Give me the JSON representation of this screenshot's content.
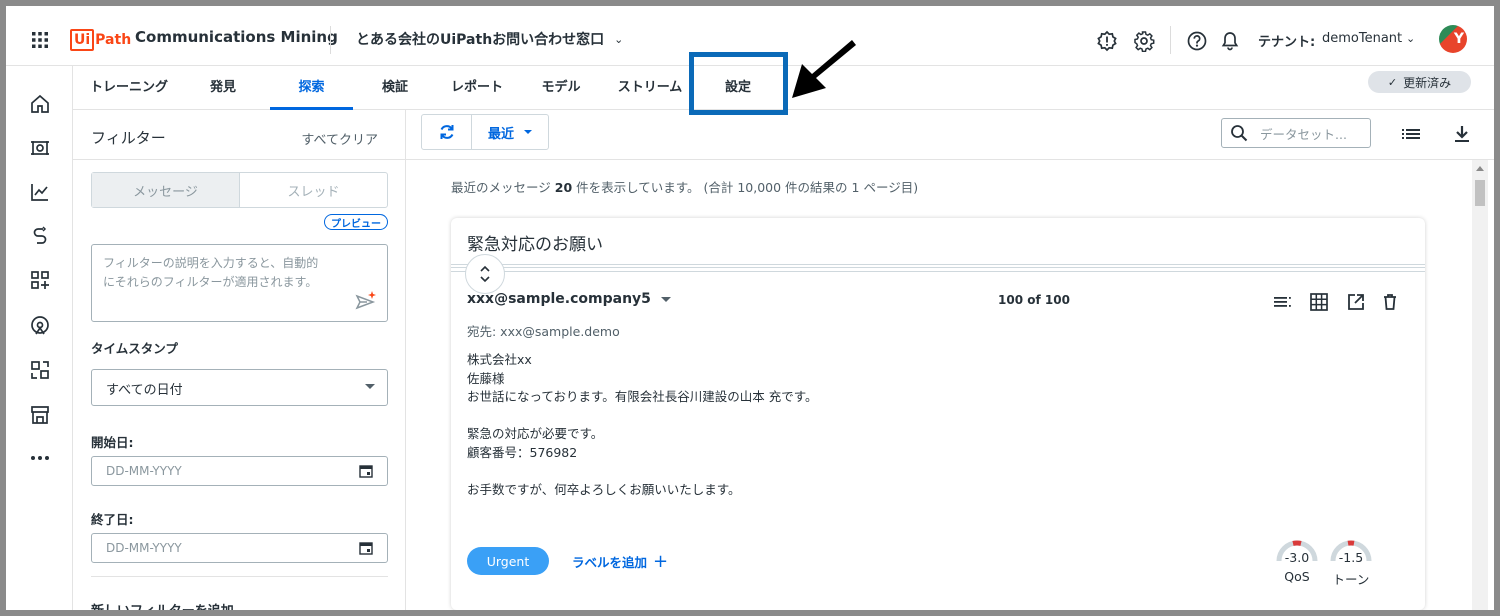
{
  "app": {
    "logo_box": "Ui",
    "logo_text": "Path",
    "product": "Communications Mining",
    "project": "とある会社のUiPathお問い合わせ窓口",
    "tenant_label": "テナント:",
    "tenant_value": "demoTenant",
    "avatar_initial": "Y"
  },
  "tabs": [
    "トレーニング",
    "発見",
    "探索",
    "検証",
    "レポート",
    "モデル",
    "ストリーム",
    "設定"
  ],
  "active_tab": "探索",
  "status": {
    "updated": "更新済み"
  },
  "filter": {
    "title": "フィルター",
    "clear": "すべてクリア",
    "segment": [
      "メッセージ",
      "スレッド"
    ],
    "preview_badge": "プレビュー",
    "description_placeholder_1": "フィルターの説明を入力すると、自動的",
    "description_placeholder_2": "にそれらのフィルターが適用されます。",
    "timestamp_label": "タイムスタンプ",
    "timestamp_value": "すべての日付",
    "start_label": "開始日:",
    "start_placeholder": "DD-MM-YYYY",
    "end_label": "終了日:",
    "end_placeholder": "DD-MM-YYYY",
    "add_filter": "新しいフィルターを追加"
  },
  "toolbar": {
    "sort": "最近",
    "search_placeholder": "データセット..."
  },
  "results": {
    "prefix": "最近のメッセージ",
    "count": "20",
    "suffix": "件を表示しています。 (合計 10,000 件の結果の 1 ページ目)"
  },
  "message": {
    "subject": "緊急対応のお願い",
    "sender": "xxx@sample.company5",
    "pager": "100 of 100",
    "to": "宛先: xxx@sample.demo",
    "body": [
      "株式会社xx",
      "佐藤様",
      "お世話になっております。有限会社長谷川建設の山本 充です。",
      "",
      "緊急の対応が必要です。",
      "顧客番号：576982",
      "",
      "お手数ですが、何卒よろしくお願いいたします。"
    ],
    "label": "Urgent",
    "add_label": "ラベルを追加",
    "scores": [
      {
        "value": "-3.0",
        "name": "QoS"
      },
      {
        "value": "-1.5",
        "name": "トーン"
      }
    ]
  },
  "colors": {
    "accent": "#0067df",
    "highlight_box": "#0b6ab8",
    "label_chip": "#3aa0f6",
    "brand": "#fa4616",
    "gauge_negative": "#d93a3a"
  }
}
